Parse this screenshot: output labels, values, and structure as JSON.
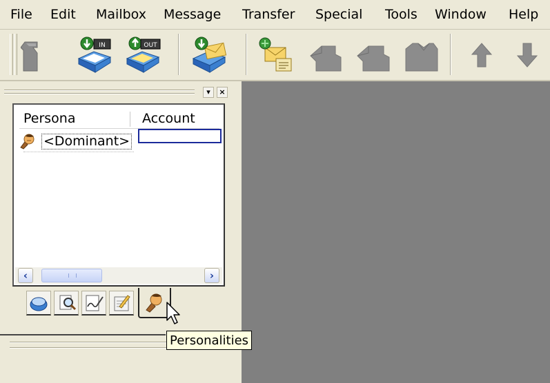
{
  "menu": {
    "items": [
      "File",
      "Edit",
      "Mailbox",
      "Message",
      "Transfer",
      "Special",
      "Tools",
      "Window",
      "Help"
    ]
  },
  "toolbar": {
    "buttons": [
      {
        "name": "mailbox-icon"
      },
      {
        "name": "in-mailbox-icon",
        "label": "IN"
      },
      {
        "name": "out-mailbox-icon",
        "label": "OUT"
      },
      {
        "name": "check-mail-icon"
      },
      {
        "name": "new-message-icon"
      },
      {
        "name": "reply-icon"
      },
      {
        "name": "reply-all-icon"
      },
      {
        "name": "forward-icon"
      },
      {
        "name": "previous-message-icon"
      },
      {
        "name": "next-message-icon"
      }
    ]
  },
  "personalities_panel": {
    "columns": {
      "persona": "Persona",
      "account": "Account"
    },
    "rows": [
      {
        "persona": "<Dominant>",
        "account": ""
      }
    ],
    "tabs": [
      "address-book-icon",
      "search-icon",
      "signatures-icon",
      "stationery-icon",
      "personalities-icon"
    ],
    "active_tab": "personalities-icon"
  },
  "tooltip": "Personalities",
  "colors": {
    "window_bg": "#ece9d8",
    "workspace": "#808080",
    "selection_border": "#1b2a9b",
    "tooltip_bg": "#ffffe1",
    "icon_gray": "#8a8a8a",
    "icon_blue": "#3a78c8"
  }
}
